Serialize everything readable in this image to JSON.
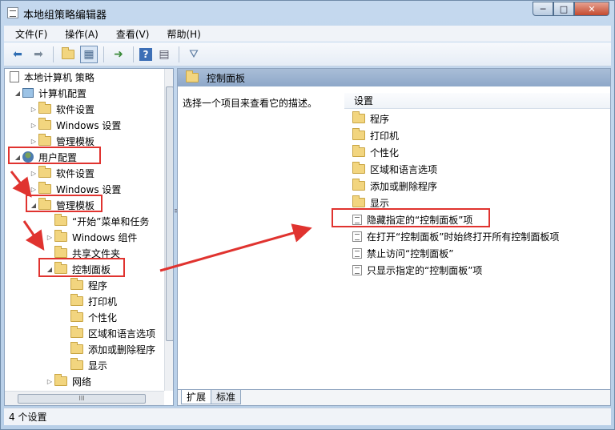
{
  "window": {
    "title": "本地组策略编辑器"
  },
  "window_buttons": {
    "minimize": "─",
    "maximize": "□",
    "close": "✕"
  },
  "menu": [
    "文件(F)",
    "操作(A)",
    "查看(V)",
    "帮助(H)"
  ],
  "toolbar": {
    "icons": [
      "back-icon",
      "forward-icon",
      "up-folder-icon",
      "show-hide-tree-icon",
      "export-list-icon",
      "help-icon",
      "properties-icon",
      "filter-icon"
    ],
    "glyphs": {
      "back": "⬅",
      "forward": "➡",
      "up": "📁",
      "tree": "▦",
      "export": "➜",
      "help": "?",
      "props": "▤",
      "filter": "⛛"
    }
  },
  "tree": {
    "root": "本地计算机 策略",
    "computer_config": "计算机配置",
    "computer_children": [
      "软件设置",
      "Windows 设置",
      "管理模板"
    ],
    "user_config": "用户配置",
    "user_children_a": [
      "软件设置",
      "Windows 设置"
    ],
    "admin_templates": "管理模板",
    "admin_children": [
      "“开始”菜单和任务",
      "Windows 组件",
      "共享文件夹"
    ],
    "control_panel": "控制面板",
    "control_panel_children": [
      "程序",
      "打印机",
      "个性化",
      "区域和语言选项",
      "添加或删除程序",
      "显示"
    ],
    "network": "网络"
  },
  "right_pane": {
    "header": "控制面板",
    "description": "选择一个项目来查看它的描述。",
    "settings_header": "设置",
    "folders": [
      "程序",
      "打印机",
      "个性化",
      "区域和语言选项",
      "添加或删除程序",
      "显示"
    ],
    "policies": [
      "隐藏指定的“控制面板”项",
      "在打开“控制面板”时始终打开所有控制面板项",
      "禁止访问“控制面板”",
      "只显示指定的“控制面板”项"
    ]
  },
  "tabs": [
    "扩展",
    "标准"
  ],
  "status": "4 个设置",
  "scroll": {
    "h_thumb": "III",
    "v_grip": "≡"
  },
  "annotation_color": "#e0332f"
}
